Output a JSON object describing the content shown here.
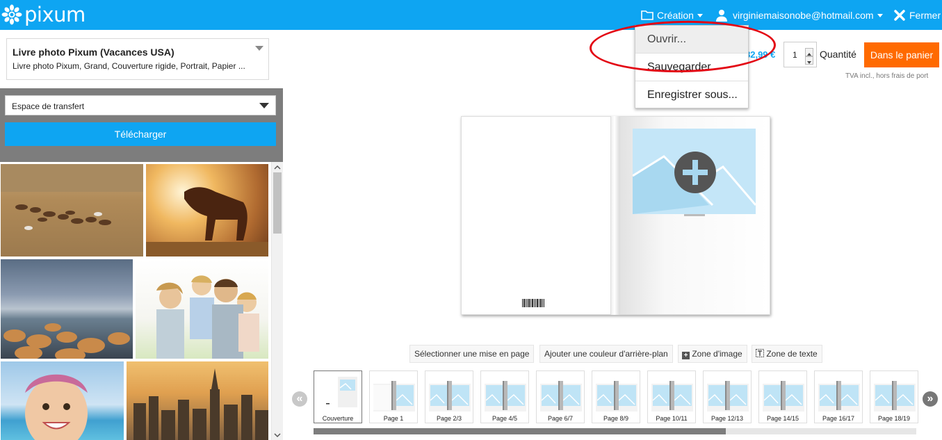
{
  "app": {
    "brand": "pixum"
  },
  "header": {
    "creation_label": "Création",
    "account_email": "virginiemaisonobe@hotmail.com",
    "close_label": "Fermer"
  },
  "product": {
    "title": "Livre photo Pixum (Vacances USA)",
    "subtitle": "Livre photo Pixum, Grand, Couverture rigide, Portrait, Papier ..."
  },
  "order": {
    "price": "82,99 €",
    "quantity": "1",
    "quantity_label": "Quantité",
    "cart_button": "Dans le panier",
    "tax_note": "TVA incl., hors frais de port"
  },
  "creation_menu": {
    "items": [
      "Ouvrir...",
      "Sauvegarder",
      "Enregistrer sous..."
    ]
  },
  "sidebar": {
    "source_select": "Espace de transfert",
    "upload_button": "Télécharger"
  },
  "editor": {
    "tools": [
      "Sélectionner une mise en page",
      "Ajouter une couleur d'arrière-plan",
      "Zone d'image",
      "Zone de texte"
    ]
  },
  "pages": [
    "Couverture",
    "Page 1",
    "Page 2/3",
    "Page 4/5",
    "Page 6/7",
    "Page 8/9",
    "Page 10/11",
    "Page 12/13",
    "Page 14/15",
    "Page 16/17",
    "Page 18/19"
  ],
  "colors": {
    "brand_blue": "#0ea5f2",
    "cart_orange": "#ff6a00",
    "annotation_red": "#e30613"
  }
}
